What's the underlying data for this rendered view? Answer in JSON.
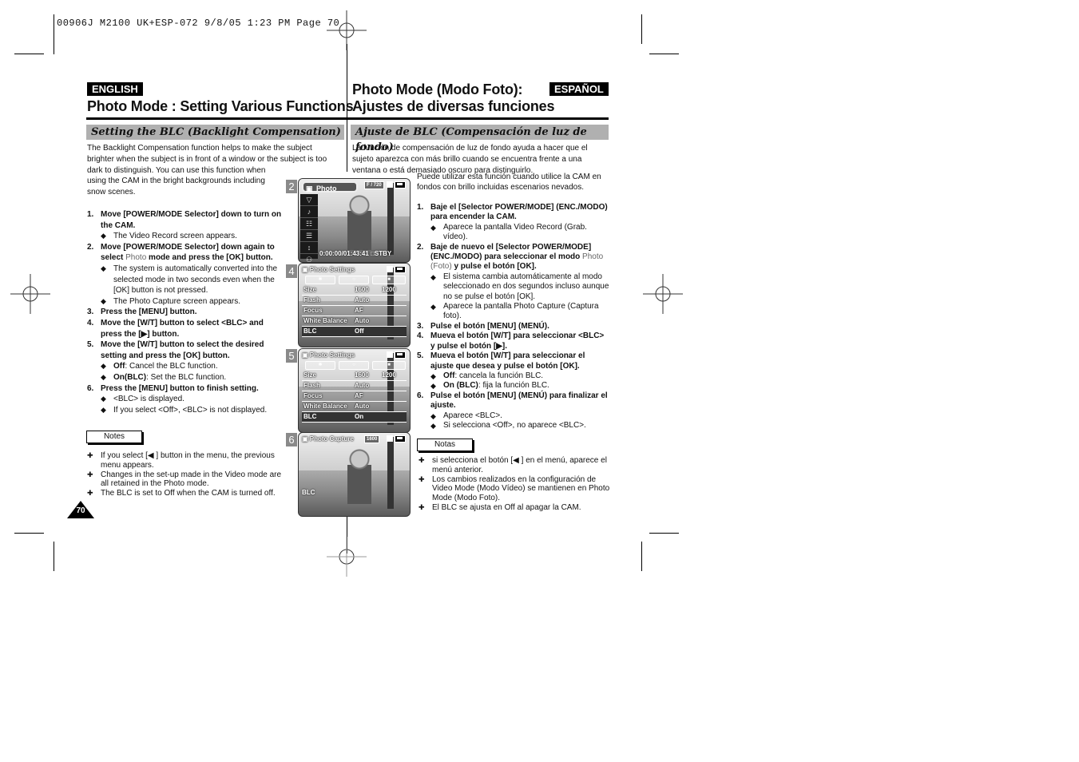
{
  "print_header": "00906J M2100 UK+ESP-072  9/8/05 1:23 PM  Page 70",
  "english": {
    "lang_badge": "ENGLISH",
    "title": "Photo Mode : Setting Various Functions",
    "section": "Setting the BLC (Backlight Compensation)",
    "intro_lines": [
      "The Backlight Compensation function helps to make the subject",
      "brighter when the subject is in front of a window or the subject is too",
      "dark to distinguish. You can use this function when",
      "using the CAM in the bright backgrounds including",
      "snow scenes."
    ],
    "steps": [
      {
        "num": "1.",
        "text": "Move [POWER/MODE Selector] down to turn on the CAM.",
        "bullets": [
          "The Video Record screen appears."
        ]
      },
      {
        "num": "2.",
        "text_before": "Move [POWER/MODE Selector] down again to select ",
        "highlight": "Photo",
        "text_after": " mode and press the [OK] button.",
        "bullets": [
          "The system is automatically converted into the selected mode in two seconds even when the [OK] button is not pressed.",
          "The Photo Capture screen appears."
        ]
      },
      {
        "num": "3.",
        "text": "Press the [MENU] button.",
        "bullets": []
      },
      {
        "num": "4.",
        "text": "Move the [W/T] button to select <BLC> and press the [▶] button.",
        "bullets": []
      },
      {
        "num": "5.",
        "text": "Move the [W/T] button to select the desired setting and press the [OK] button.",
        "bullets": []
      },
      {
        "num": "6.",
        "text": "Press the [MENU] button to finish setting.",
        "bullets": [
          "<BLC> is displayed.",
          "If you select <Off>, <BLC> is not displayed."
        ]
      }
    ],
    "step5_options": [
      {
        "label": "Off",
        "desc": ": Cancel the BLC function."
      },
      {
        "label": "On(BLC)",
        "desc": ": Set the BLC function."
      }
    ],
    "notes_label": "Notes",
    "notes": [
      "If you select [◀ ] button in the menu, the previous menu appears.",
      "Changes in the set-up made in the Video mode are all retained in the Photo mode.",
      "The BLC is set to Off when the CAM is turned off."
    ],
    "page_number": "70"
  },
  "spanish": {
    "lang_badge": "ESPAÑOL",
    "title_line1": "Photo Mode (Modo Foto):",
    "title_line2": "Ajustes de diversas funciones",
    "section": "Ajuste de BLC (Compensación de luz de fondo)",
    "intro_lines": [
      "La función de compensación de luz de fondo ayuda a hacer que el",
      "sujeto aparezca con más brillo cuando se encuentra frente a una",
      "ventana o está demasiado oscuro para distinguirlo."
    ],
    "intro2_lines": [
      "Puede utilizar esta función cuando utilice la CAM en",
      "fondos con brillo incluidas escenarios nevados."
    ],
    "steps": [
      {
        "num": "1.",
        "text": "Baje el [Selector POWER/MODE] (ENC./MODO) para encender la CAM.",
        "bullets": [
          "Aparece la pantalla Video Record (Grab. vídeo)."
        ]
      },
      {
        "num": "2.",
        "text_before": "Baje de nuevo el [Selector POWER/MODE] (ENC./MODO) para seleccionar el modo ",
        "highlight": "Photo (Foto)",
        "text_after": " y pulse el botón [OK].",
        "bullets": [
          "El sistema cambia automáticamente al modo seleccionado en dos segundos incluso aunque no se pulse el botón [OK].",
          "Aparece la pantalla Photo Capture (Captura foto)."
        ]
      },
      {
        "num": "3.",
        "text": "Pulse el botón [MENU] (MENÚ).",
        "bullets": []
      },
      {
        "num": "4.",
        "text": "Mueva el botón [W/T] para seleccionar <BLC> y pulse el botón [▶].",
        "bullets": []
      },
      {
        "num": "5.",
        "text": "Mueva el botón [W/T] para seleccionar el ajuste que desea y pulse el botón [OK].",
        "bullets": []
      },
      {
        "num": "6.",
        "text": "Pulse el botón [MENU] (MENÚ) para finalizar el ajuste.",
        "bullets": [
          "Aparece <BLC>.",
          "Si selecciona <Off>, no aparece <BLC>."
        ]
      }
    ],
    "step5_options": [
      {
        "label": "Off",
        "desc": ": cancela la función BLC."
      },
      {
        "label": "On (BLC)",
        "desc": ": fija la función BLC."
      }
    ],
    "notes_label": "Notas",
    "notes": [
      "si selecciona el botón [◀ ] en el menú, aparece el menú anterior.",
      "Los cambios realizados en la configuración de Video Mode (Modo Vídeo) se mantienen en Photo Mode (Modo Foto).",
      "El BLC se ajusta en Off al apagar la CAM."
    ]
  },
  "screens": [
    {
      "step": "2",
      "pill": "Photo",
      "res": "F / 720",
      "sidebar_icons": [
        "▽",
        "♪",
        "☷",
        "☰",
        "↕",
        "⚇"
      ],
      "bottom": "0:00:00/01:43:41 □STBY"
    },
    {
      "step": "4",
      "title": "Photo Settings",
      "rows": [
        {
          "k": "Size",
          "v": "1600",
          "v2": "1200"
        },
        {
          "k": "Flash",
          "v": "Auto"
        },
        {
          "k": "Focus",
          "v": "AF"
        },
        {
          "k": "White Balance",
          "v": "Auto"
        },
        {
          "k": "BLC",
          "v": "Off",
          "selected": true
        }
      ]
    },
    {
      "step": "5",
      "title": "Photo Settings",
      "rows": [
        {
          "k": "Size",
          "v": "1600",
          "v2": "1200"
        },
        {
          "k": "Flash",
          "v": "Auto"
        },
        {
          "k": "Focus",
          "v": "AF"
        },
        {
          "k": "White Balance",
          "v": "Auto"
        },
        {
          "k": "BLC",
          "v": "On",
          "selected": true
        }
      ]
    },
    {
      "step": "6",
      "title": "Photo Capture",
      "res": "1600",
      "blc_label": "BLC"
    }
  ]
}
